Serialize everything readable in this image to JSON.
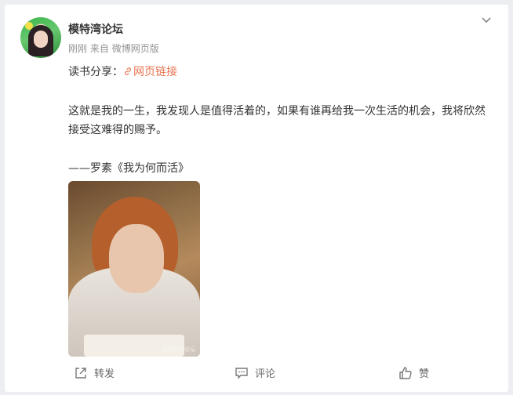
{
  "post": {
    "username": "模特湾论坛",
    "time": "刚刚",
    "source_prefix": "来自",
    "source": "微博网页版",
    "lead_text": "读书分享：",
    "link_text": "网页链接",
    "body": "这就是我的一生，我发现人是值得活着的，如果有谁再给我一次生活的机会，我将欣然接受这难得的赐予。",
    "quote": "——罗素《我为何而活》",
    "image_watermark": "@模特湾论坛"
  },
  "actions": {
    "repost": "转发",
    "comment": "评论",
    "like": "赞"
  },
  "colors": {
    "link": "#eb7350",
    "meta": "#939393",
    "text": "#333333"
  },
  "icons": {
    "menu": "chevron-down-icon",
    "link": "link-icon",
    "repost": "repost-icon",
    "comment": "comment-icon",
    "like": "thumbs-up-icon"
  }
}
